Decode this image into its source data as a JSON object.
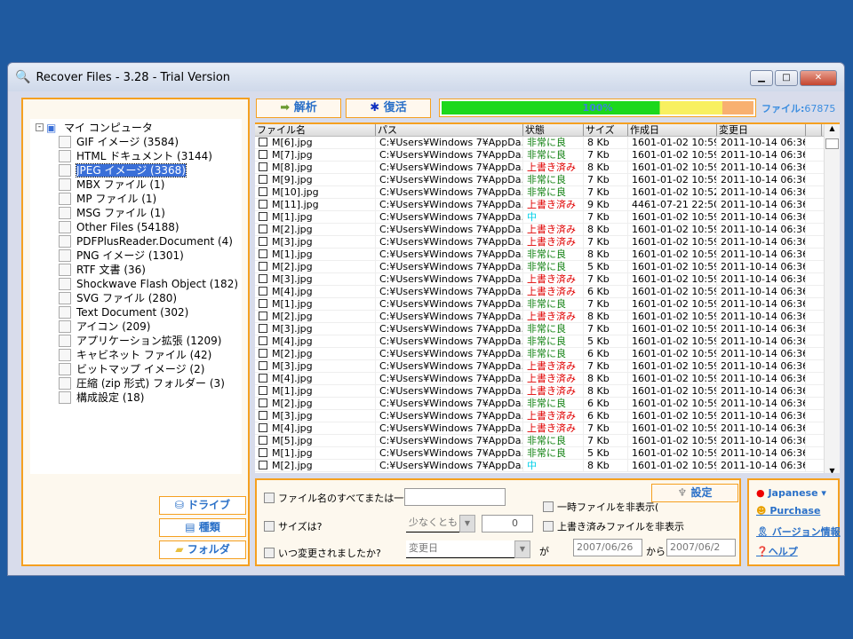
{
  "window": {
    "title": "Recover Files - 3.28 - Trial Version"
  },
  "tree": {
    "root": "マイ コンピュータ",
    "items": [
      {
        "label": "GIF イメージ (3584)"
      },
      {
        "label": "HTML ドキュメント (3144)"
      },
      {
        "label": "JPEG イメージ (3368)",
        "selected": true
      },
      {
        "label": "MBX ファイル (1)"
      },
      {
        "label": "MP ファイル (1)"
      },
      {
        "label": "MSG ファイル (1)"
      },
      {
        "label": "Other Files (54188)"
      },
      {
        "label": "PDFPlusReader.Document (4)"
      },
      {
        "label": "PNG イメージ (1301)"
      },
      {
        "label": "RTF 文書 (36)"
      },
      {
        "label": "Shockwave Flash Object (182)"
      },
      {
        "label": "SVG ファイル (280)"
      },
      {
        "label": "Text Document (302)"
      },
      {
        "label": "アイコン (209)"
      },
      {
        "label": "アプリケーション拡張 (1209)"
      },
      {
        "label": "キャビネット ファイル (42)"
      },
      {
        "label": "ビットマップ イメージ (2)"
      },
      {
        "label": "圧縮 (zip 形式) フォルダー (3)"
      },
      {
        "label": "構成設定 (18)"
      }
    ]
  },
  "left_buttons": {
    "drive": "ドライブ",
    "type": "種類",
    "folder": "フォルダ"
  },
  "toolbar": {
    "analyze": "解析",
    "recover": "復活",
    "progress_label": "100%",
    "progress": 100,
    "file_count_label": "ファイル:",
    "file_count": "67875"
  },
  "table": {
    "columns": [
      "ファイル名",
      "パス",
      "状態",
      "サイズ",
      "作成日",
      "変更日"
    ],
    "rows": [
      [
        "M[6].jpg",
        "C:¥Users¥Windows 7¥AppDa...",
        "非常に良",
        "8 Kb",
        "1601-01-02 10:59",
        "2011-10-14 06:36",
        "good"
      ],
      [
        "M[7].jpg",
        "C:¥Users¥Windows 7¥AppDa...",
        "非常に良",
        "7 Kb",
        "1601-01-02 10:59",
        "2011-10-14 06:36",
        "good"
      ],
      [
        "M[8].jpg",
        "C:¥Users¥Windows 7¥AppDa...",
        "上書き済み",
        "8 Kb",
        "1601-01-02 10:59",
        "2011-10-14 06:36",
        "over"
      ],
      [
        "M[9].jpg",
        "C:¥Users¥Windows 7¥AppDa...",
        "非常に良",
        "7 Kb",
        "1601-01-02 10:59",
        "2011-10-14 06:36",
        "good"
      ],
      [
        "M[10].jpg",
        "C:¥Users¥Windows 7¥AppDa...",
        "非常に良",
        "7 Kb",
        "1601-01-02 10:52",
        "2011-10-14 06:36",
        "good"
      ],
      [
        "M[11].jpg",
        "C:¥Users¥Windows 7¥AppDa...",
        "上書き済み",
        "9 Kb",
        "4461-07-21 22:50",
        "2011-10-14 06:36",
        "over"
      ],
      [
        "M[1].jpg",
        "C:¥Users¥Windows 7¥AppDa...",
        "中",
        "7 Kb",
        "1601-01-02 10:59",
        "2011-10-14 06:36",
        "mid"
      ],
      [
        "M[2].jpg",
        "C:¥Users¥Windows 7¥AppDa...",
        "上書き済み",
        "8 Kb",
        "1601-01-02 10:59",
        "2011-10-14 06:36",
        "over"
      ],
      [
        "M[3].jpg",
        "C:¥Users¥Windows 7¥AppDa...",
        "上書き済み",
        "7 Kb",
        "1601-01-02 10:59",
        "2011-10-14 06:36",
        "over"
      ],
      [
        "M[1].jpg",
        "C:¥Users¥Windows 7¥AppDa...",
        "非常に良",
        "8 Kb",
        "1601-01-02 10:59",
        "2011-10-14 06:36",
        "good"
      ],
      [
        "M[2].jpg",
        "C:¥Users¥Windows 7¥AppDa...",
        "非常に良",
        "5 Kb",
        "1601-01-02 10:59",
        "2011-10-14 06:36",
        "good"
      ],
      [
        "M[3].jpg",
        "C:¥Users¥Windows 7¥AppDa...",
        "上書き済み",
        "7 Kb",
        "1601-01-02 10:59",
        "2011-10-14 06:36",
        "over"
      ],
      [
        "M[4].jpg",
        "C:¥Users¥Windows 7¥AppDa...",
        "上書き済み",
        "6 Kb",
        "1601-01-02 10:59",
        "2011-10-14 06:36",
        "over"
      ],
      [
        "M[1].jpg",
        "C:¥Users¥Windows 7¥AppDa...",
        "非常に良",
        "7 Kb",
        "1601-01-02 10:59",
        "2011-10-14 06:36",
        "good"
      ],
      [
        "M[2].jpg",
        "C:¥Users¥Windows 7¥AppDa...",
        "上書き済み",
        "8 Kb",
        "1601-01-02 10:59",
        "2011-10-14 06:36",
        "over"
      ],
      [
        "M[3].jpg",
        "C:¥Users¥Windows 7¥AppDa...",
        "非常に良",
        "7 Kb",
        "1601-01-02 10:59",
        "2011-10-14 06:36",
        "good"
      ],
      [
        "M[4].jpg",
        "C:¥Users¥Windows 7¥AppDa...",
        "非常に良",
        "5 Kb",
        "1601-01-02 10:59",
        "2011-10-14 06:36",
        "good"
      ],
      [
        "M[2].jpg",
        "C:¥Users¥Windows 7¥AppDa...",
        "非常に良",
        "6 Kb",
        "1601-01-02 10:59",
        "2011-10-14 06:36",
        "good"
      ],
      [
        "M[3].jpg",
        "C:¥Users¥Windows 7¥AppDa...",
        "上書き済み",
        "7 Kb",
        "1601-01-02 10:59",
        "2011-10-14 06:36",
        "over"
      ],
      [
        "M[4].jpg",
        "C:¥Users¥Windows 7¥AppDa...",
        "上書き済み",
        "8 Kb",
        "1601-01-02 10:59",
        "2011-10-14 06:36",
        "over"
      ],
      [
        "M[1].jpg",
        "C:¥Users¥Windows 7¥AppDa...",
        "上書き済み",
        "8 Kb",
        "1601-01-02 10:59",
        "2011-10-14 06:36",
        "over"
      ],
      [
        "M[2].jpg",
        "C:¥Users¥Windows 7¥AppDa...",
        "非常に良",
        "6 Kb",
        "1601-01-02 10:59",
        "2011-10-14 06:36",
        "good"
      ],
      [
        "M[3].jpg",
        "C:¥Users¥Windows 7¥AppDa...",
        "上書き済み",
        "6 Kb",
        "1601-01-02 10:59",
        "2011-10-14 06:36",
        "over"
      ],
      [
        "M[4].jpg",
        "C:¥Users¥Windows 7¥AppDa...",
        "上書き済み",
        "7 Kb",
        "1601-01-02 10:59",
        "2011-10-14 06:36",
        "over"
      ],
      [
        "M[5].jpg",
        "C:¥Users¥Windows 7¥AppDa...",
        "非常に良",
        "7 Kb",
        "1601-01-02 10:59",
        "2011-10-14 06:36",
        "good"
      ],
      [
        "M[1].jpg",
        "C:¥Users¥Windows 7¥AppDa...",
        "非常に良",
        "5 Kb",
        "1601-01-02 10:59",
        "2011-10-14 06:36",
        "good"
      ],
      [
        "M[2].jpg",
        "C:¥Users¥Windows 7¥AppDa...",
        "中",
        "8 Kb",
        "1601-01-02 10:59",
        "2011-10-14 06:36",
        "mid"
      ]
    ]
  },
  "filters": {
    "name_label": "ファイル名のすべてまたは一部",
    "name_value": "",
    "size_label": "サイズは?",
    "size_op": "少なくとも",
    "size_value": "0",
    "modified_label": "いつ変更されましたか?",
    "date_type": "変更日",
    "ga": "が",
    "from_date": "2007/06/26",
    "kara": "から",
    "to_date": "2007/06/2",
    "hide_temp": "一時ファイルを非表示(",
    "hide_overwritten": "上書き済みファイルを非表示",
    "settings": "設定"
  },
  "side": {
    "language": "Japanese",
    "purchase": "Purchase",
    "version": "バージョン情報",
    "help": "ヘルプ"
  },
  "colors": {
    "accent": "#f5a020",
    "link": "#2a70c8",
    "good": "#108010",
    "overwritten": "#e00000",
    "medium": "#00d0e8"
  }
}
